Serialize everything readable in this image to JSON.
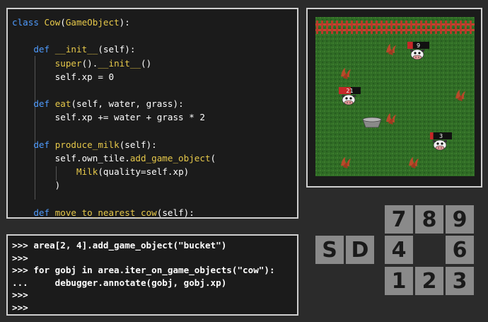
{
  "code_editor": {
    "lines": [
      [
        {
          "c": "kw",
          "t": "class "
        },
        {
          "c": "cls",
          "t": "Cow"
        },
        {
          "c": "txt",
          "t": "("
        },
        {
          "c": "cls",
          "t": "GameObject"
        },
        {
          "c": "txt",
          "t": "):"
        }
      ],
      [],
      [
        {
          "c": "txt",
          "t": "    "
        },
        {
          "c": "kw",
          "t": "def "
        },
        {
          "c": "fn",
          "t": "__init__"
        },
        {
          "c": "txt",
          "t": "(self):"
        }
      ],
      [
        {
          "c": "txt",
          "t": "        "
        },
        {
          "c": "fn",
          "t": "super"
        },
        {
          "c": "txt",
          "t": "()."
        },
        {
          "c": "fn",
          "t": "__init__"
        },
        {
          "c": "txt",
          "t": "()"
        }
      ],
      [
        {
          "c": "txt",
          "t": "        self.xp = 0"
        }
      ],
      [],
      [
        {
          "c": "txt",
          "t": "    "
        },
        {
          "c": "kw",
          "t": "def "
        },
        {
          "c": "fn",
          "t": "eat"
        },
        {
          "c": "txt",
          "t": "(self, water, grass):"
        }
      ],
      [
        {
          "c": "txt",
          "t": "        self.xp += water + grass * 2"
        }
      ],
      [],
      [
        {
          "c": "txt",
          "t": "    "
        },
        {
          "c": "kw",
          "t": "def "
        },
        {
          "c": "fn",
          "t": "produce_milk"
        },
        {
          "c": "txt",
          "t": "(self):"
        }
      ],
      [
        {
          "c": "txt",
          "t": "        self.own_tile."
        },
        {
          "c": "fn",
          "t": "add_game_object"
        },
        {
          "c": "txt",
          "t": "("
        }
      ],
      [
        {
          "c": "txt",
          "t": "            "
        },
        {
          "c": "cls",
          "t": "Milk"
        },
        {
          "c": "txt",
          "t": "(quality=self.xp)"
        }
      ],
      [
        {
          "c": "txt",
          "t": "        )"
        }
      ],
      [],
      [
        {
          "c": "txt",
          "t": "    "
        },
        {
          "c": "kw",
          "t": "def "
        },
        {
          "c": "fn",
          "t": "move_to_nearest_cow"
        },
        {
          "c": "txt",
          "t": "(self):"
        }
      ]
    ]
  },
  "repl": {
    "lines": [
      ">>> area[2, 4].add_game_object(\"bucket\")",
      ">>>",
      ">>> for gobj in area.iter_on_game_objects(\"cow\"):",
      "...     debugger.annotate(gobj, gobj.xp)",
      ">>>",
      ">>>"
    ]
  },
  "game_view": {
    "cows": [
      {
        "label": "9",
        "xp_fill": 0.25
      },
      {
        "label": "21",
        "xp_fill": 0.55
      },
      {
        "label": "3",
        "xp_fill": 0.15
      }
    ],
    "object_names": [
      "fence",
      "cow",
      "bucket",
      "grass-tuft"
    ]
  },
  "keypad": {
    "mode_keys": [
      "S",
      "D"
    ],
    "rows": [
      [
        "7",
        "8",
        "9"
      ],
      [
        "4",
        "",
        "6"
      ],
      [
        "1",
        "2",
        "3"
      ]
    ]
  },
  "colors": {
    "keyword": "#4f9cff",
    "class_name": "#e6c84a",
    "grass": "#2f6b25",
    "fence": "#b83a2a",
    "key_bg": "#8a8a8a"
  }
}
